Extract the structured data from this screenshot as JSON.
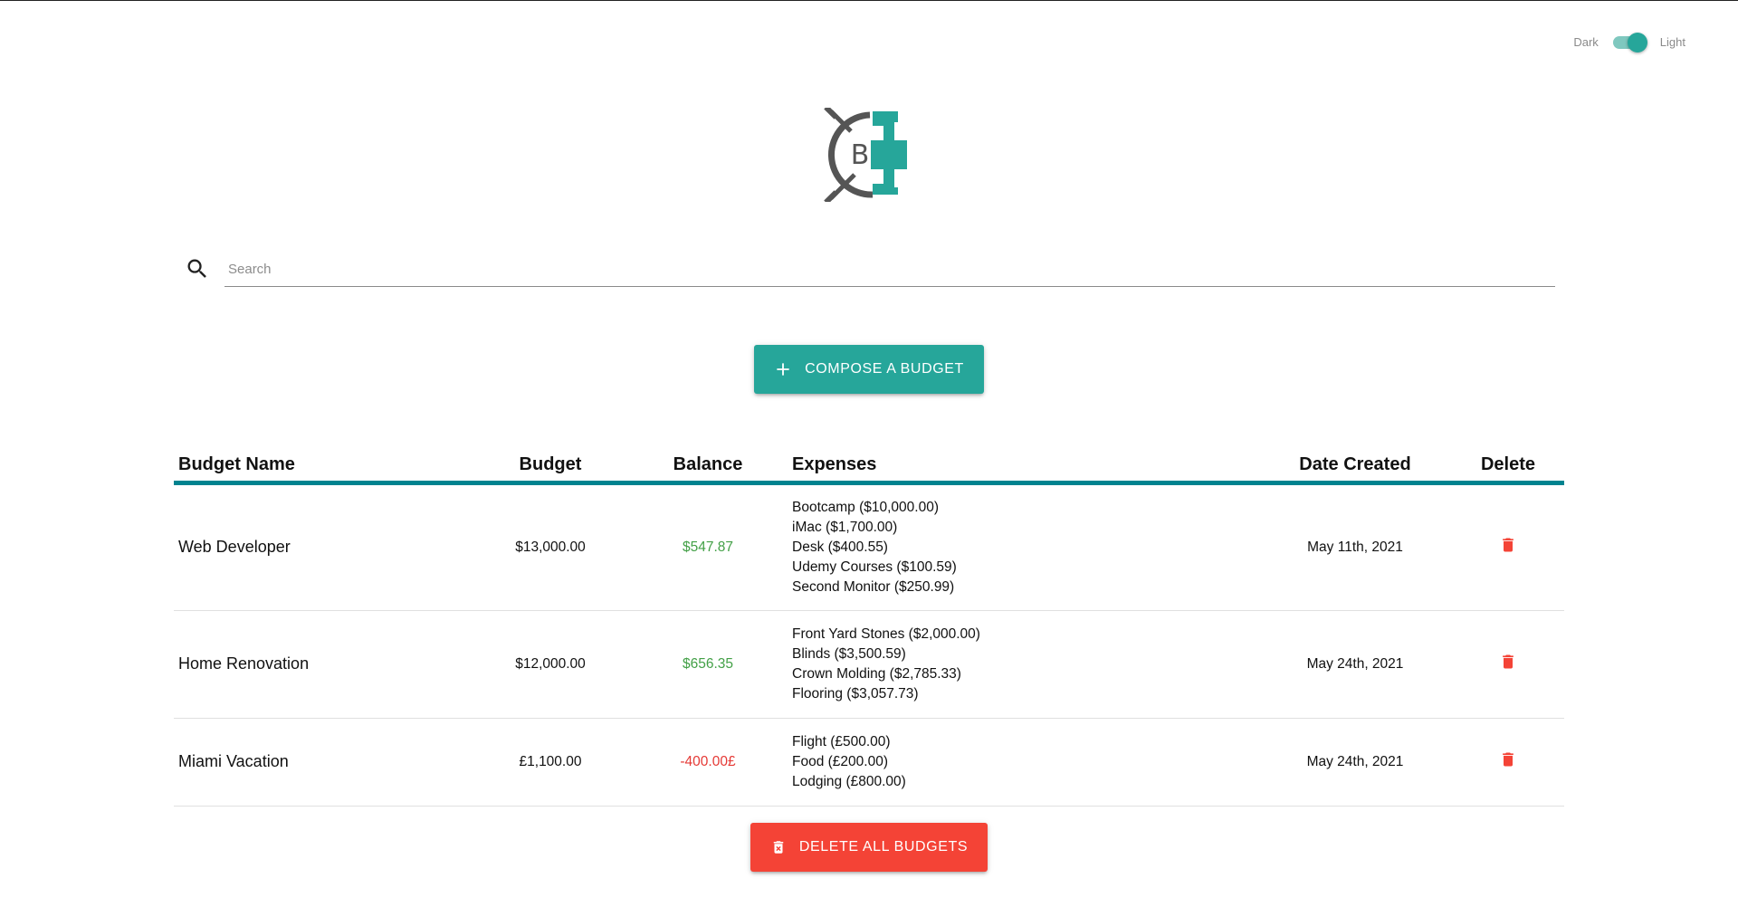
{
  "theme_toggle": {
    "dark_label": "Dark",
    "light_label": "Light",
    "selected": "Light"
  },
  "logo": {
    "letter": "B"
  },
  "search": {
    "placeholder": "Search",
    "value": ""
  },
  "compose_button": {
    "label": "Compose a budget"
  },
  "table": {
    "headers": {
      "name": "Budget Name",
      "budget": "Budget",
      "balance": "Balance",
      "expenses": "Expenses",
      "date": "Date Created",
      "delete": "Delete"
    },
    "rows": [
      {
        "name": "Web Developer",
        "budget": "$13,000.00",
        "balance": "$547.87",
        "balance_status": "positive",
        "expenses": [
          "Bootcamp ($10,000.00)",
          "iMac ($1,700.00)",
          "Desk ($400.55)",
          "Udemy Courses ($100.59)",
          "Second Monitor ($250.99)"
        ],
        "date": "May 11th, 2021"
      },
      {
        "name": "Home Renovation",
        "budget": "$12,000.00",
        "balance": "$656.35",
        "balance_status": "positive",
        "expenses": [
          "Front Yard Stones ($2,000.00)",
          "Blinds ($3,500.59)",
          "Crown Molding ($2,785.33)",
          "Flooring ($3,057.73)"
        ],
        "date": "May 24th, 2021"
      },
      {
        "name": "Miami Vacation",
        "budget": "£1,100.00",
        "balance": "-400.00£",
        "balance_status": "negative",
        "expenses": [
          "Flight (£500.00)",
          "Food (£200.00)",
          "Lodging (£800.00)"
        ],
        "date": "May 24th, 2021"
      }
    ]
  },
  "delete_all_button": {
    "label": "Delete all budgets"
  },
  "icons": {
    "search": "search-icon",
    "compose": "plus-icon",
    "row_delete": "trash-icon",
    "delete_all": "trash-x-icon"
  },
  "colors": {
    "primary": "#26a69a",
    "table_rule": "#00838f",
    "danger": "#f44336",
    "positive": "#43a047",
    "negative": "#e53935",
    "logo_gray": "#555555"
  }
}
